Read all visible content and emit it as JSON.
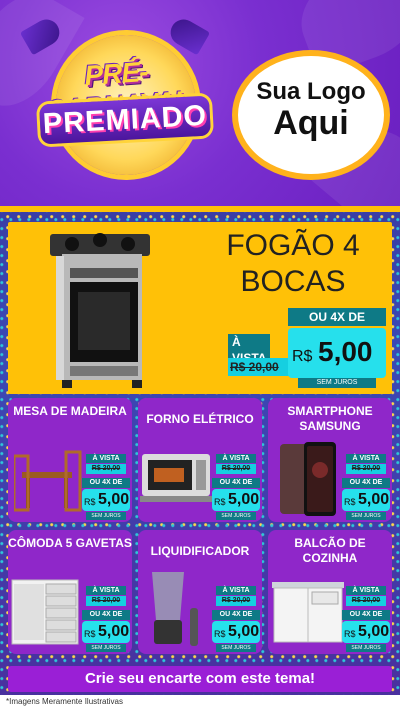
{
  "header": {
    "title_line1": "PRÉ-CARNAVAL",
    "title_line2": "PREMIADO",
    "logo_line1": "Sua Logo",
    "logo_line2": "Aqui"
  },
  "featured": {
    "name": "FOGÃO 4 BOCAS",
    "vista_label": "À VISTA",
    "old_price": "R$ 20,00",
    "installment_label": "OU 4X DE",
    "currency": "R$",
    "price": "5,00",
    "no_interest": "SEM JUROS"
  },
  "products": [
    {
      "name": "MESA DE MADEIRA",
      "vista_label": "À VISTA",
      "old_price": "R$ 20,00",
      "installment_label": "OU 4X DE",
      "currency": "R$",
      "price": "5,00",
      "no_interest": "SEM JUROS"
    },
    {
      "name": "FORNO ELÉTRICO",
      "vista_label": "À VISTA",
      "old_price": "R$ 20,00",
      "installment_label": "OU 4X DE",
      "currency": "R$",
      "price": "5,00",
      "no_interest": "SEM JUROS"
    },
    {
      "name": "SMARTPHONE SAMSUNG",
      "vista_label": "À VISTA",
      "old_price": "R$ 20,00",
      "installment_label": "OU 4X DE",
      "currency": "R$",
      "price": "5,00",
      "no_interest": "SEM JUROS"
    },
    {
      "name": "CÔMODA 5 GAVETAS",
      "vista_label": "À VISTA",
      "old_price": "R$ 20,00",
      "installment_label": "OU 4X DE",
      "currency": "R$",
      "price": "5,00",
      "no_interest": "SEM JUROS"
    },
    {
      "name": "LIQUIDIFICADOR",
      "vista_label": "À VISTA",
      "old_price": "R$ 20,00",
      "installment_label": "OU 4X DE",
      "currency": "R$",
      "price": "5,00",
      "no_interest": "SEM JUROS"
    },
    {
      "name": "BALCÃO DE COZINHA",
      "vista_label": "À VISTA",
      "old_price": "R$ 20,00",
      "installment_label": "OU 4X DE",
      "currency": "R$",
      "price": "5,00",
      "no_interest": "SEM JUROS"
    }
  ],
  "footer": {
    "cta": "Crie seu encarte com este tema!",
    "disclaimer": "*Imagens Meramente Ilustrativas"
  },
  "colors": {
    "accent_yellow": "#ffc107",
    "card_purple": "#8f27c9",
    "tag_teal": "#0e7a86",
    "tag_cyan": "#26e0ec"
  }
}
